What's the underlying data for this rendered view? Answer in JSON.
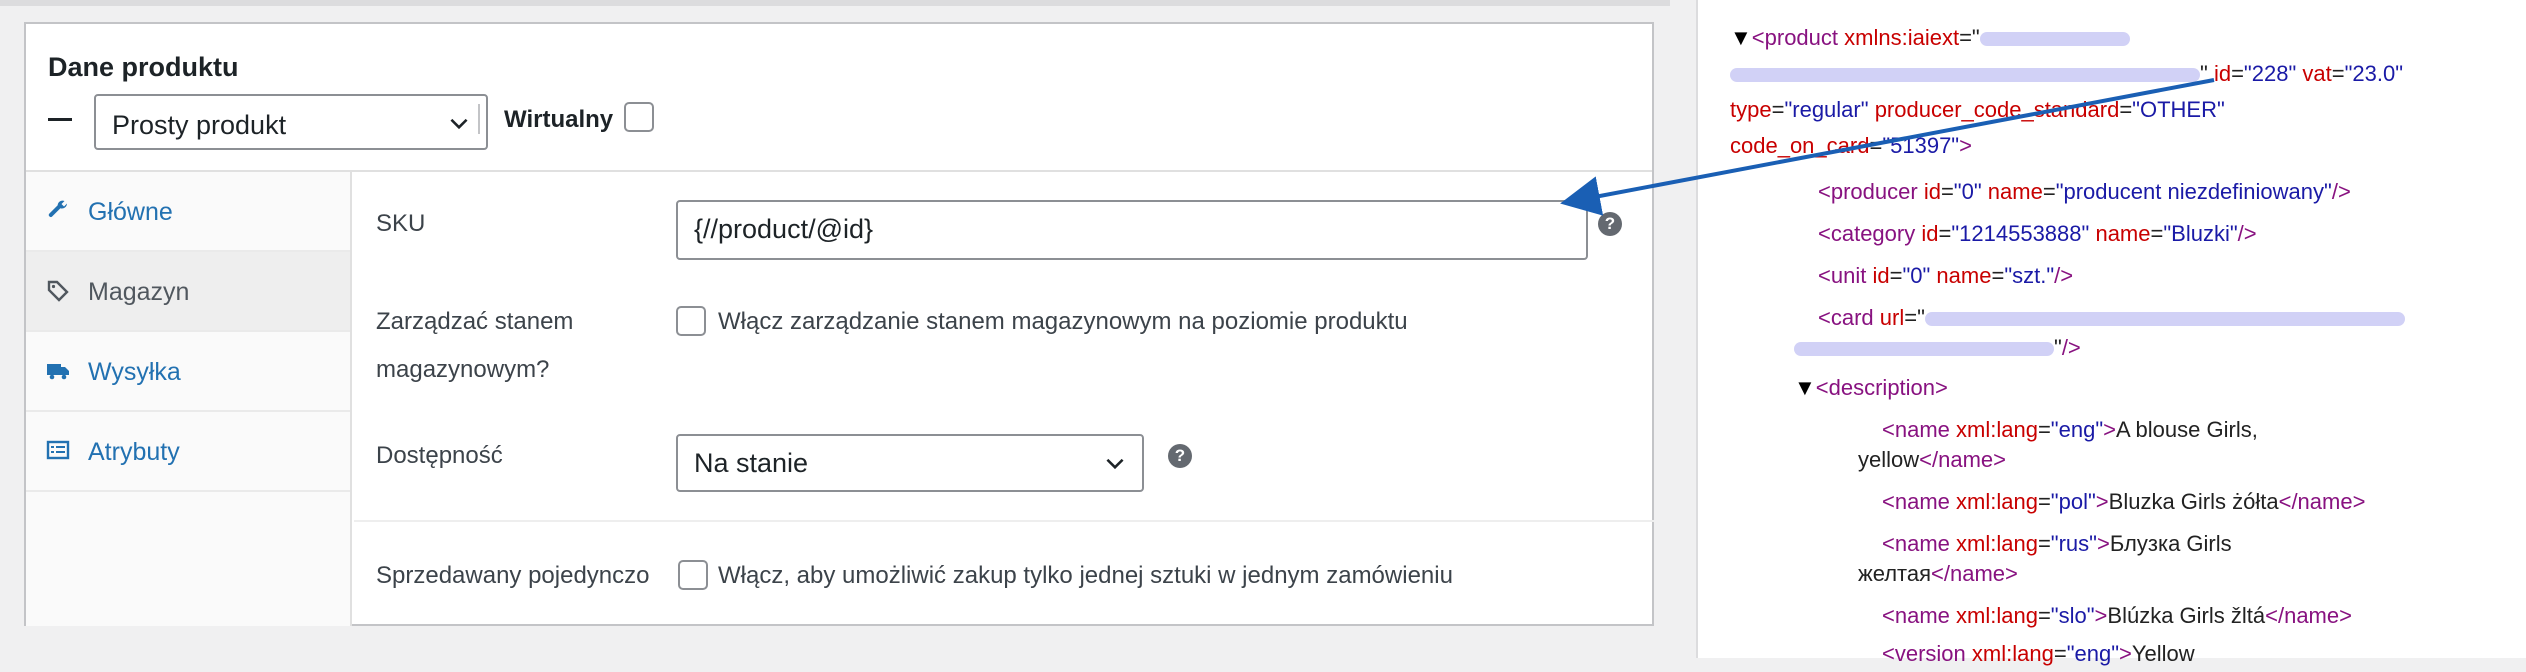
{
  "panel": {
    "title": "Dane produktu",
    "product_type": "Prosty produkt",
    "virtual_label": "Wirtualny"
  },
  "tabs": [
    {
      "label": "Główne",
      "icon": "wrench-icon"
    },
    {
      "label": "Magazyn",
      "icon": "tag-icon"
    },
    {
      "label": "Wysyłka",
      "icon": "truck-icon"
    },
    {
      "label": "Atrybuty",
      "icon": "list-icon"
    }
  ],
  "inventory": {
    "sku_label": "SKU",
    "sku_value": "{//product/@id}",
    "manage_label_1": "Zarządzać stanem",
    "manage_label_2": "magazynowym?",
    "manage_check_text": "Włącz zarządzanie stanem magazynowym na poziomie produktu",
    "availability_label": "Dostępność",
    "availability_value": "Na stanie",
    "sold_label": "Sprzedawany pojedynczo",
    "sold_check_text": "Włącz, aby umożliwić zakup tylko jednej sztuki w jednym zamówieniu"
  },
  "xml": {
    "l1_tag": "<product",
    "l1_attr": "xmlns:iaiext",
    "l2_id_attr": "id",
    "l2_id_val": "\"228\"",
    "l2_vat_attr": "vat",
    "l2_vat_val": "\"23.0\"",
    "l3_type_attr": "type",
    "l3_type_val": "\"regular\"",
    "l3_pcs_attr": "producer_code_standard",
    "l3_pcs_val": "\"OTHER\"",
    "l4_attr": "code_on_card",
    "l4_val": "\"51397\"",
    "producer_tag": "<producer",
    "producer_id_attr": "id",
    "producer_id_val": "\"0\"",
    "producer_name_attr": "name",
    "producer_name_val": "\"producent niezdefiniowany\"",
    "category_tag": "<category",
    "category_id_attr": "id",
    "category_id_val": "\"1214553888\"",
    "category_name_attr": "name",
    "category_name_val": "\"Bluzki\"",
    "unit_tag": "<unit",
    "unit_id_attr": "id",
    "unit_id_val": "\"0\"",
    "unit_name_attr": "name",
    "unit_name_val": "\"szt.\"",
    "card_tag": "<card",
    "card_attr": "url",
    "description_tag": "<description>",
    "name_tag": "<name",
    "lang_attr": "xml:lang",
    "eng_val": "\"eng\"",
    "eng_text_1": "A blouse Girls,",
    "eng_text_2": "yellow",
    "pol_val": "\"pol\"",
    "pol_text": "Bluzka Girls żółta",
    "rus_val": "\"rus\"",
    "rus_text_1": "Блузка Girls",
    "rus_text_2": "желтая",
    "slo_val": "\"slo\"",
    "slo_text": "Blúzka Girls žltá",
    "close_name": "</name>",
    "version_tag": "<version",
    "version_text": "Yellow"
  }
}
